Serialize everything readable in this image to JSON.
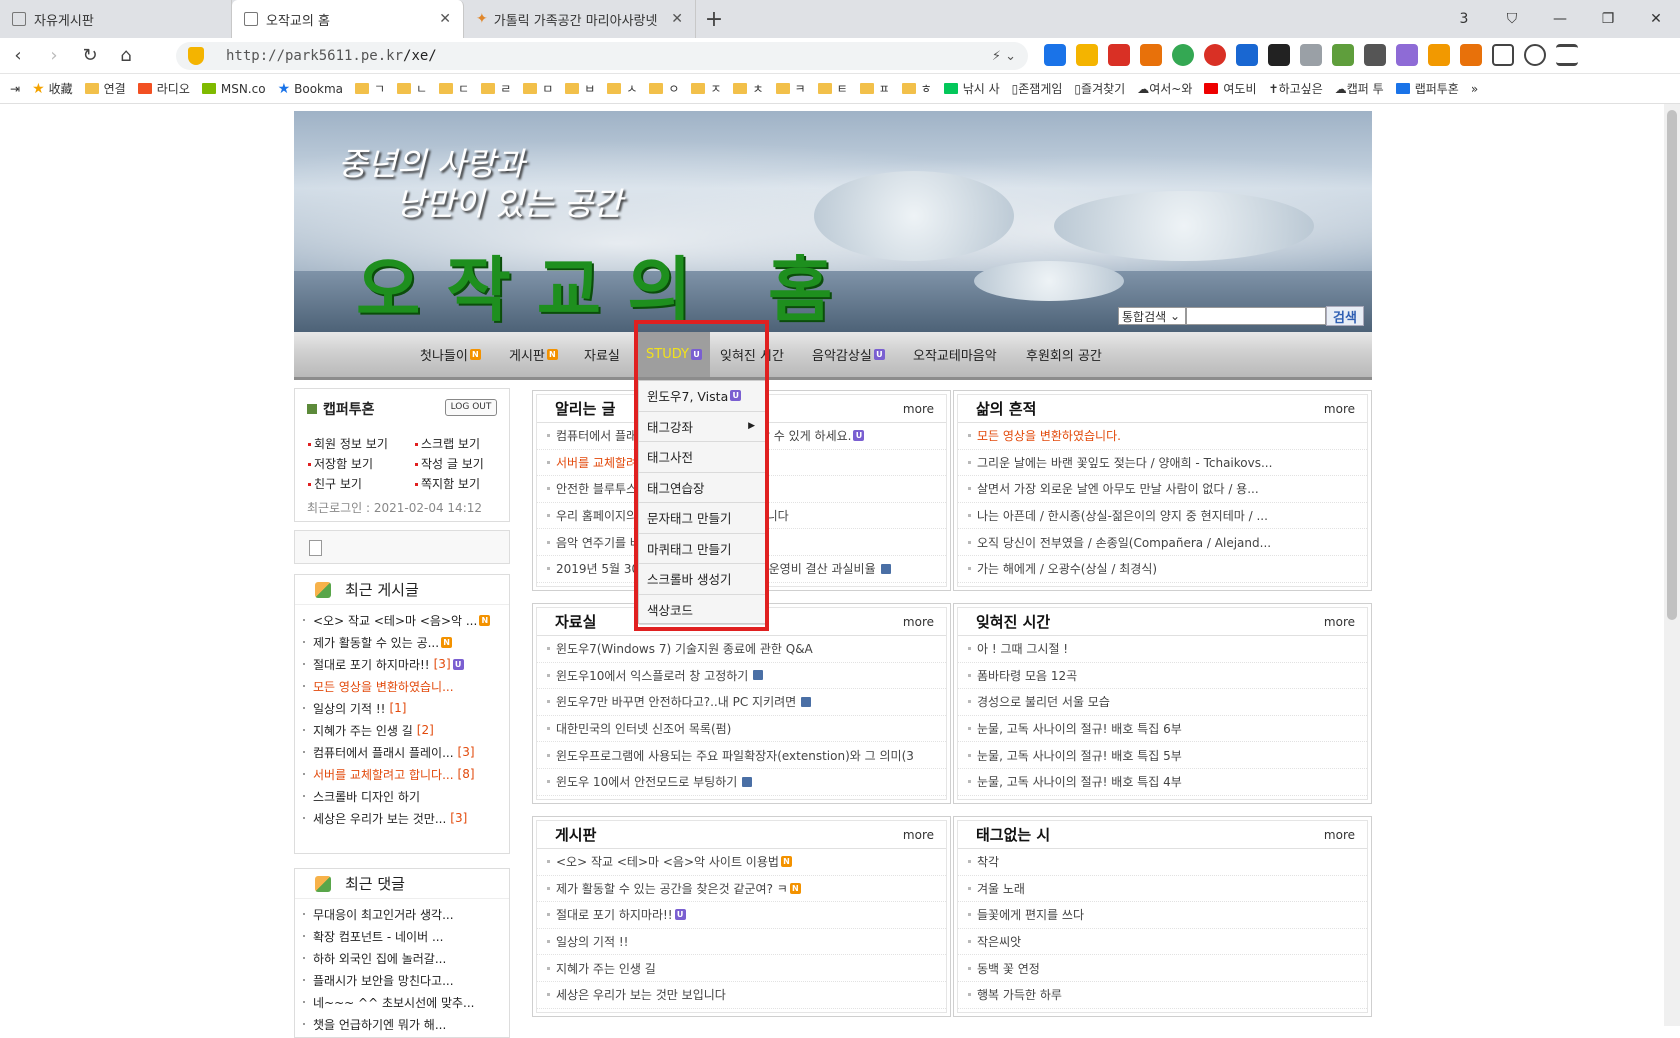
{
  "browser": {
    "tabs": [
      {
        "label": "자유게시판",
        "active": false
      },
      {
        "label": "오작교의 홈",
        "active": true
      },
      {
        "label": "가톨릭 가족공간 마리아사랑넷",
        "active": false
      }
    ],
    "tab_count": "3",
    "url_host": "http://park5611.pe.kr",
    "url_path": "/xe/"
  },
  "bookmarks": [
    "收藏",
    "연결",
    "라디오",
    "MSN.co",
    "Bookma",
    "ㄱ",
    "ㄴ",
    "ㄷ",
    "ㄹ",
    "ㅁ",
    "ㅂ",
    "ㅅ",
    "ㅇ",
    "ㅈ",
    "ㅊ",
    "ㅋ",
    "ㅌ",
    "ㅍ",
    "ㅎ",
    "낚시 사",
    "존잼게임",
    "즐겨찾기",
    "여서~와",
    "여도비",
    "하고싶은",
    "캡퍼 투",
    "랩퍼투혼"
  ],
  "banner": {
    "line1": "중년의 사랑과",
    "line2": "낭만이 있는 공간",
    "title": "오작교의 홈"
  },
  "search": {
    "scope": "통합검색",
    "button": "검색"
  },
  "menu": [
    {
      "label": "첫나들이",
      "badge": "N"
    },
    {
      "label": "게시판",
      "badge": "N"
    },
    {
      "label": "자료실",
      "badge": ""
    },
    {
      "label": "STUDY",
      "badge": "U"
    },
    {
      "label": "잊혀진 시간",
      "badge": ""
    },
    {
      "label": "음악감상실",
      "badge": "U"
    },
    {
      "label": "오작교테마음악",
      "badge": ""
    },
    {
      "label": "후원회의 공간",
      "badge": ""
    }
  ],
  "study_dropdown": [
    "윈도우7, Vista",
    "태그강좌",
    "태그사전",
    "태그연습장",
    "문자태그 만들기",
    "마퀴태그 만들기",
    "스크롤바 생성기",
    "색상코드"
  ],
  "login": {
    "user": "캡퍼투혼",
    "logout": "LOG OUT",
    "links": [
      "회원 정보 보기",
      "스크랩 보기",
      "저장함 보기",
      "작성 글 보기",
      "친구 보기",
      "쪽지함 보기"
    ],
    "last_login": "최근로그인 : 2021-02-04 14:12"
  },
  "recent_posts": {
    "title": "최근 게시글",
    "items": [
      {
        "text": "<오> 작교 <테>마 <음>악 ...",
        "count": "",
        "badge": "N",
        "hl": false
      },
      {
        "text": "제가 활동할 수 있는 공...",
        "count": "",
        "badge": "N",
        "hl": false
      },
      {
        "text": "절대로 포기 하지마라!!",
        "count": "[3]",
        "badge": "U",
        "hl": false
      },
      {
        "text": "모든 영상을 변환하였습니...",
        "count": "",
        "badge": "",
        "hl": true
      },
      {
        "text": "일상의 기적 !!",
        "count": "[1]",
        "badge": "",
        "hl": false
      },
      {
        "text": "지혜가 주는 인생 길",
        "count": "[2]",
        "badge": "",
        "hl": false
      },
      {
        "text": "컴퓨터에서 플래시 플레이...",
        "count": "[3]",
        "badge": "",
        "hl": false
      },
      {
        "text": "서버를 교체할려고 합니다...",
        "count": "[8]",
        "badge": "",
        "hl": true
      },
      {
        "text": "스크롤바 디자인 하기",
        "count": "",
        "badge": "",
        "hl": false
      },
      {
        "text": "세상은 우리가 보는 것만...",
        "count": "[3]",
        "badge": "",
        "hl": false
      }
    ]
  },
  "recent_comments": {
    "title": "최근 댓글",
    "items": [
      "무대응이 최고인거라 생각...",
      "확장 컴포넌트 - 네이버 ...",
      "하하 외국인 집에 놀러갈...",
      "플래시가 보안을 망친다고...",
      "네~~~ ^^ 초보시선에 맞추...",
      "챗을 언급하기엔 뭐가 해..."
    ]
  },
  "panels": [
    {
      "title": "알리는 글",
      "more": "more",
      "items": [
        {
          "text": "컴퓨터에서 플래시 플레이어를 다시 사용할 수 있게 하세요.",
          "mark": "U",
          "hl": false
        },
        {
          "text": "서버를 교체할려고 합니다.",
          "mark": "",
          "hl": true
        },
        {
          "text": "안전한 블루투스 파일 교환 방법",
          "mark": "disk",
          "hl": false
        },
        {
          "text": "우리 홈페이지의 글을 통합 검색할 수 있습니다",
          "mark": "",
          "hl": false
        },
        {
          "text": "음악 연주기를 바꾸었습니다",
          "mark": "",
          "hl": false
        },
        {
          "text": "2019년 5월 30일 홈페이지 서버 이전 및 운영비 결산 과실비율",
          "mark": "disk",
          "hl": false
        }
      ]
    },
    {
      "title": "삶의 흔적",
      "more": "more",
      "items": [
        {
          "text": "모든 영상을 변환하였습니다.",
          "mark": "",
          "hl": true
        },
        {
          "text": "그리운 날에는 바랜 꽃잎도 젖는다 / 양애희 - Tchaikovs...",
          "mark": "",
          "hl": false
        },
        {
          "text": "살면서 가장 외로운 날엔 아무도 만날 사람이 없다 / 용...",
          "mark": "",
          "hl": false
        },
        {
          "text": "나는 아픈데 / 한시종(상실-젊은이의 양지 중 현지테마 / ...",
          "mark": "",
          "hl": false
        },
        {
          "text": "오직 당신이 전부였을 / 손종일(Compañera / Alejand...",
          "mark": "",
          "hl": false
        },
        {
          "text": "가는 해에게 / 오광수(상실 / 최경식)",
          "mark": "",
          "hl": false
        }
      ]
    },
    {
      "title": "자료실",
      "more": "more",
      "items": [
        {
          "text": "윈도우7(Windows 7) 기술지원 종료에 관한 Q&A",
          "mark": "",
          "hl": false
        },
        {
          "text": "윈도우10에서 익스플로러 창 고정하기",
          "mark": "disk",
          "hl": false
        },
        {
          "text": "윈도우7만 바꾸면 안전하다고?..내 PC 지키려면",
          "mark": "disk",
          "hl": false
        },
        {
          "text": "대한민국의 인터넷 신조어 목록(펌)",
          "mark": "",
          "hl": false
        },
        {
          "text": "윈도우프로그램에 사용되는 주요 파일확장자(extenstion)와 그 의미(3",
          "mark": "",
          "hl": false
        },
        {
          "text": "윈도우 10에서 안전모드로 부팅하기",
          "mark": "disk",
          "hl": false
        }
      ]
    },
    {
      "title": "잊혀진 시간",
      "more": "more",
      "items": [
        {
          "text": "아 ! 그때 그시절 !",
          "mark": "",
          "hl": false
        },
        {
          "text": "폼바타령 모음 12곡",
          "mark": "",
          "hl": false
        },
        {
          "text": "경성으로 불리던 서울 모습",
          "mark": "",
          "hl": false
        },
        {
          "text": "눈물, 고독 사나이의 절규! 배호 특집 6부",
          "mark": "",
          "hl": false
        },
        {
          "text": "눈물, 고독 사나이의 절규! 배호 특집 5부",
          "mark": "",
          "hl": false
        },
        {
          "text": "눈물, 고독 사나이의 절규! 배호 특집 4부",
          "mark": "",
          "hl": false
        }
      ]
    },
    {
      "title": "게시판",
      "more": "more",
      "items": [
        {
          "text": "<오> 작교 <테>마 <음>악 사이트 이용법",
          "mark": "N",
          "hl": false
        },
        {
          "text": "제가 활동할 수 있는 공간을 찾은것 같군여? ㅋ",
          "mark": "N",
          "hl": false
        },
        {
          "text": "절대로 포기 하지마라!!",
          "mark": "U",
          "hl": false
        },
        {
          "text": "일상의 기적 !!",
          "mark": "",
          "hl": false
        },
        {
          "text": "지혜가 주는 인생 길",
          "mark": "",
          "hl": false
        },
        {
          "text": "세상은 우리가 보는 것만 보입니다",
          "mark": "",
          "hl": false
        }
      ]
    },
    {
      "title": "태그없는 시",
      "more": "more",
      "items": [
        {
          "text": "착각",
          "mark": "",
          "hl": false
        },
        {
          "text": "겨울 노래",
          "mark": "",
          "hl": false
        },
        {
          "text": "들꽃에게 편지를 쓰다",
          "mark": "",
          "hl": false
        },
        {
          "text": "작은씨앗",
          "mark": "",
          "hl": false
        },
        {
          "text": "동백 꽃 연정",
          "mark": "",
          "hl": false
        },
        {
          "text": "행복 가득한 하루",
          "mark": "",
          "hl": false
        }
      ]
    }
  ]
}
